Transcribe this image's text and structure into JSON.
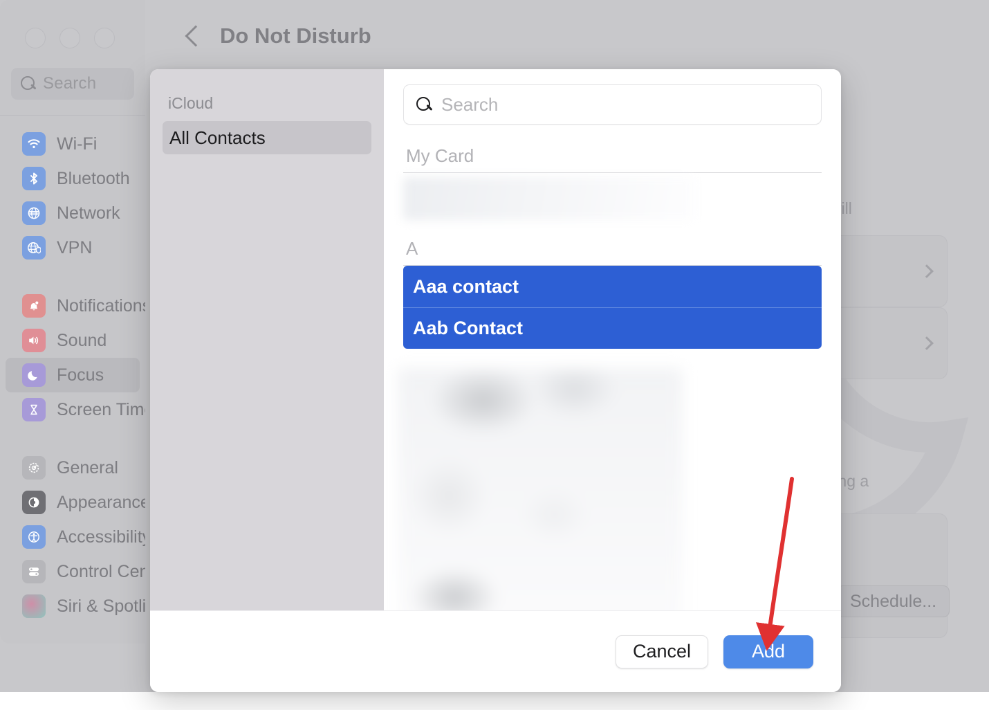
{
  "window": {
    "title": "Do Not Disturb",
    "back_icon": "chevron-left-icon",
    "search_placeholder": "Search",
    "search_icon": "search-icon"
  },
  "sidebar": {
    "groups": [
      {
        "items": [
          {
            "label": "Wi-Fi",
            "icon": "wifi-icon",
            "color": "blue",
            "glyph": "◝",
            "selected": false
          },
          {
            "label": "Bluetooth",
            "icon": "bluetooth-icon",
            "color": "blue",
            "glyph": "ᛦ",
            "selected": false
          },
          {
            "label": "Network",
            "icon": "globe-icon",
            "color": "blue",
            "glyph": "⊕",
            "selected": false
          },
          {
            "label": "VPN",
            "icon": "vpn-globe-shield-icon",
            "color": "blue",
            "glyph": "⊕",
            "selected": false
          }
        ]
      },
      {
        "items": [
          {
            "label": "Notifications",
            "icon": "bell-icon",
            "color": "red",
            "glyph": "▲",
            "selected": false
          },
          {
            "label": "Sound",
            "icon": "speaker-icon",
            "color": "pink",
            "glyph": "◀",
            "selected": false
          },
          {
            "label": "Focus",
            "icon": "moon-icon",
            "color": "purple",
            "glyph": "☾",
            "selected": true
          },
          {
            "label": "Screen Time",
            "icon": "hourglass-icon",
            "color": "purple",
            "glyph": "⧖",
            "selected": false
          }
        ]
      },
      {
        "items": [
          {
            "label": "General",
            "icon": "gear-icon",
            "color": "grey",
            "glyph": "⚙",
            "selected": false
          },
          {
            "label": "Appearance",
            "icon": "appearance-icon",
            "color": "dark",
            "glyph": "◑",
            "selected": false
          },
          {
            "label": "Accessibility",
            "icon": "accessibility-icon",
            "color": "bblue",
            "glyph": "Ⓙ",
            "selected": false
          },
          {
            "label": "Control Center",
            "icon": "control-center-icon",
            "color": "grey",
            "glyph": "≡",
            "selected": false
          },
          {
            "label": "Siri & Spotlight",
            "icon": "siri-icon",
            "color": "siri",
            "glyph": "",
            "selected": false
          }
        ]
      }
    ]
  },
  "background_content": {
    "text_fragment_1": "s will",
    "text_fragment_2": "using a",
    "schedule_button": "Schedule...",
    "row_chevron_icon": "chevron-right-icon",
    "watermark_icon": "moon-watermark-icon"
  },
  "sheet": {
    "sources": {
      "header": "iCloud",
      "items": [
        {
          "label": "All Contacts",
          "selected": true
        }
      ]
    },
    "search": {
      "placeholder": "Search",
      "value": "",
      "icon": "search-icon"
    },
    "sections": [
      {
        "header": "My Card",
        "contacts": [
          {
            "name": "",
            "selected": false,
            "redacted": true
          }
        ]
      },
      {
        "header": "A",
        "contacts": [
          {
            "name": "Aaa contact",
            "selected": true,
            "redacted": false
          },
          {
            "name": "Aab Contact",
            "selected": true,
            "redacted": false
          }
        ]
      }
    ],
    "footer": {
      "cancel_label": "Cancel",
      "add_label": "Add"
    }
  },
  "annotation": {
    "arrow_color": "#e03131",
    "points_to": "Add"
  },
  "colors": {
    "selection_blue": "#2d5fd4",
    "primary_button_blue": "#4e8ae8",
    "window_chrome": "#c8c8cb",
    "sheet_sidebar": "#d8d6da"
  }
}
